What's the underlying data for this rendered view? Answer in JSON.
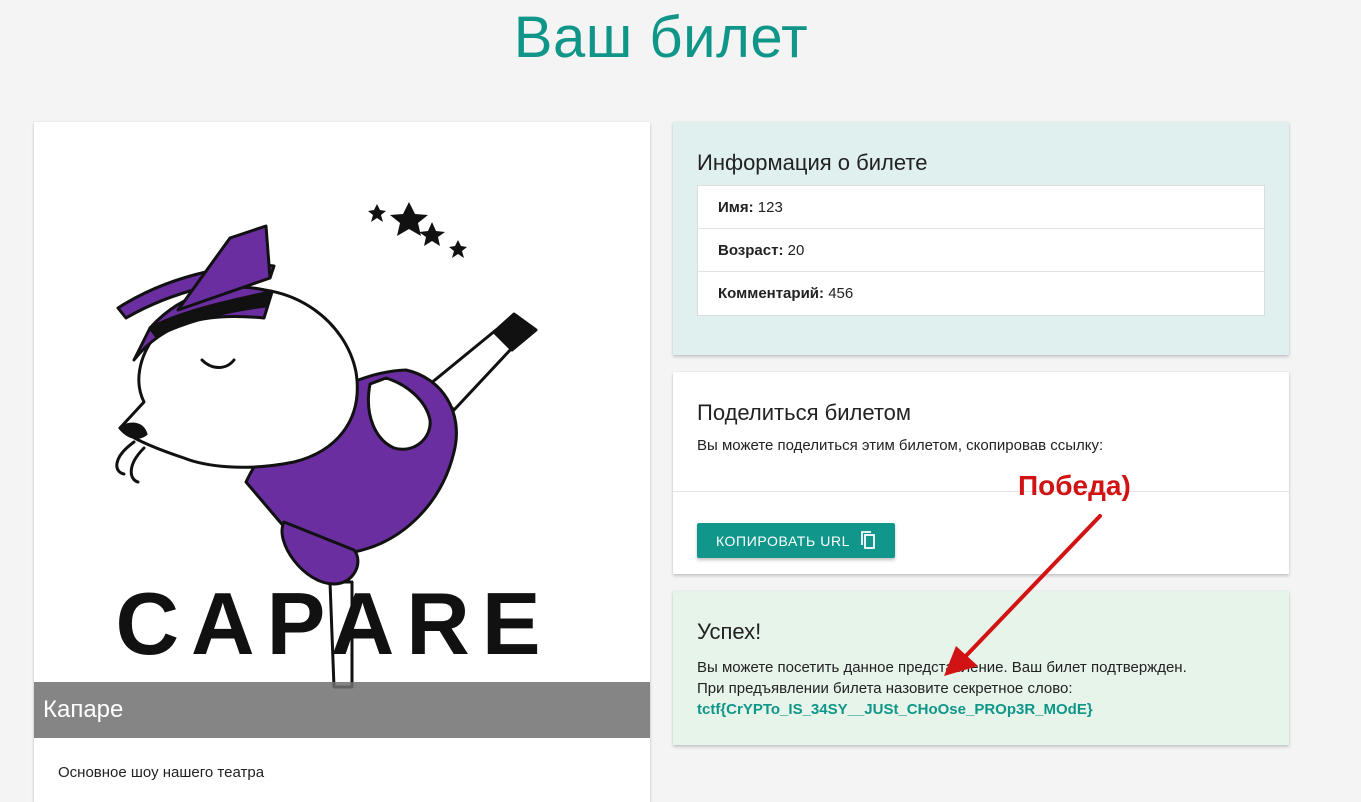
{
  "page": {
    "title": "Ваш билет"
  },
  "show": {
    "logo_text": "CAPARE",
    "caption": "Капаре",
    "description": "Основное шоу нашего театра"
  },
  "ticket_info": {
    "title": "Информация о билете",
    "rows": [
      {
        "label": "Имя:",
        "value": "123"
      },
      {
        "label": "Возраст:",
        "value": "20"
      },
      {
        "label": "Комментарий:",
        "value": "456"
      }
    ]
  },
  "share": {
    "title": "Поделиться билетом",
    "text": "Вы можете поделиться этим билетом, скопировав ссылку:",
    "copy_button": "КОПИРОВАТЬ URL",
    "copy_icon": "content-copy-icon"
  },
  "success": {
    "title": "Успех!",
    "line1": "Вы можете посетить данное представление. Ваш билет подтвержден.",
    "line2": "При предъявлении билета назовите секретное слово:",
    "secret": "tctf{CrYPTo_IS_34SY__JUSt_CHoOse_PROp3R_MOdE}"
  },
  "annotation": {
    "label": "Победа)",
    "color": "#d21313"
  },
  "colors": {
    "accent": "#0f9688",
    "info_bg": "#dff0ee",
    "success_bg": "#e6f4ea",
    "costume": "#6a2ea0"
  }
}
